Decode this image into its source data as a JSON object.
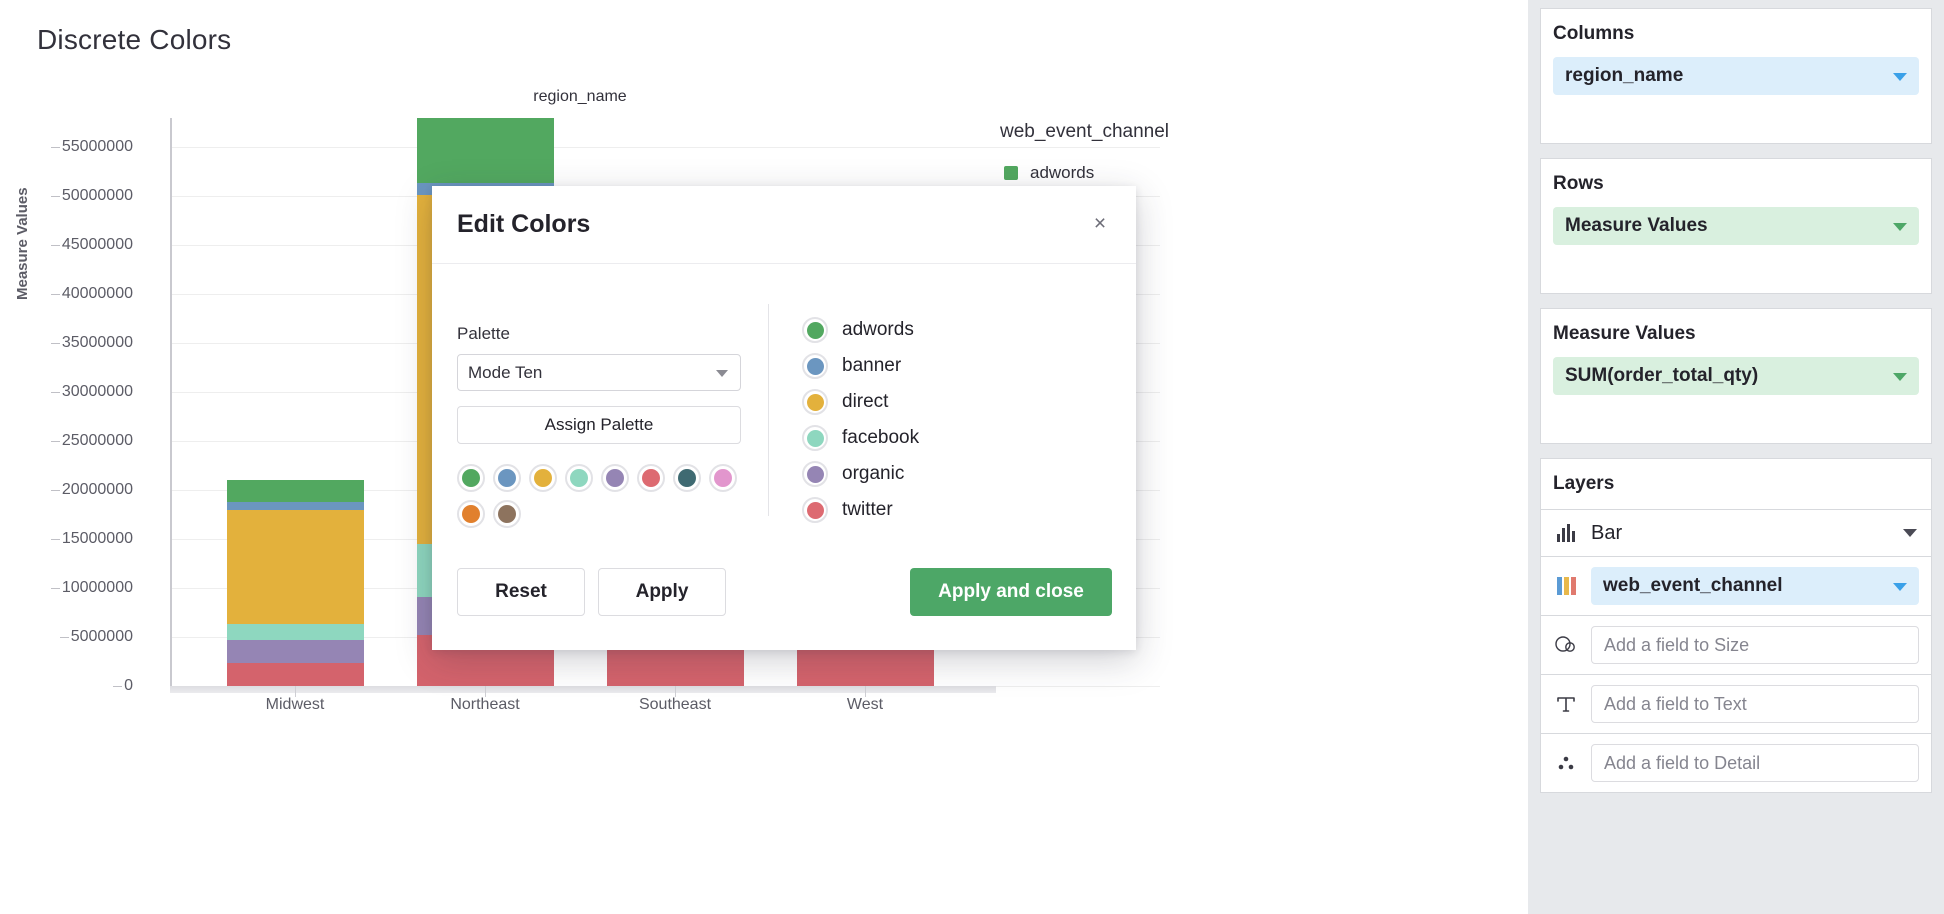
{
  "viz": {
    "title": "Discrete Colors",
    "columns_field_label": "region_name",
    "y_axis_title": "Measure Values",
    "legend_title": "web_event_channel",
    "legend_first_item": "adwords"
  },
  "chart_data": {
    "type": "bar",
    "title": "Discrete Colors",
    "xlabel": "region_name",
    "ylabel": "Measure Values",
    "ylim": [
      0,
      58000000
    ],
    "grid": true,
    "stacked": true,
    "legend_position": "right",
    "legend_title": "web_event_channel",
    "categories": [
      "Midwest",
      "Northeast",
      "Southeast",
      "West"
    ],
    "ytick_labels": [
      "0",
      "5000000",
      "10000000",
      "15000000",
      "20000000",
      "25000000",
      "30000000",
      "35000000",
      "40000000",
      "45000000",
      "50000000",
      "55000000"
    ],
    "ytick_values": [
      0,
      5000000,
      10000000,
      15000000,
      20000000,
      25000000,
      30000000,
      35000000,
      40000000,
      45000000,
      50000000,
      55000000
    ],
    "series": [
      {
        "name": "twitter",
        "color": "#d4636c",
        "values": [
          2300000,
          5200000,
          4300000,
          5100000
        ]
      },
      {
        "name": "organic",
        "color": "#9585b4",
        "values": [
          2400000,
          3900000,
          3600000,
          3700000
        ]
      },
      {
        "name": "facebook",
        "color": "#8ed7bf",
        "values": [
          1600000,
          5400000,
          0,
          0
        ]
      },
      {
        "name": "direct",
        "color": "#e3b13c",
        "values": [
          11700000,
          35600000,
          0,
          0
        ]
      },
      {
        "name": "banner",
        "color": "#6b96c0",
        "values": [
          800000,
          1300000,
          0,
          0
        ]
      },
      {
        "name": "adwords",
        "color": "#52a860",
        "values": [
          2200000,
          6600000,
          0,
          0
        ]
      }
    ]
  },
  "modal": {
    "title": "Edit Colors",
    "close_label": "×",
    "palette_label": "Palette",
    "palette_value": "Mode Ten",
    "assign_palette_label": "Assign Palette",
    "swatches": [
      {
        "name": "green",
        "color": "#52a860"
      },
      {
        "name": "blue",
        "color": "#6b96c0"
      },
      {
        "name": "yellow",
        "color": "#e3b13c"
      },
      {
        "name": "mint",
        "color": "#8ed7bf"
      },
      {
        "name": "purple",
        "color": "#9585b4"
      },
      {
        "name": "red",
        "color": "#dd6a71"
      },
      {
        "name": "dark-teal",
        "color": "#3f6a72"
      },
      {
        "name": "pink",
        "color": "#e296cd"
      },
      {
        "name": "orange",
        "color": "#e1802d"
      },
      {
        "name": "brown",
        "color": "#8d735e"
      }
    ],
    "legend_items": [
      {
        "label": "adwords",
        "color": "#52a860"
      },
      {
        "label": "banner",
        "color": "#6b96c0"
      },
      {
        "label": "direct",
        "color": "#e3b13c"
      },
      {
        "label": "facebook",
        "color": "#8ed7bf"
      },
      {
        "label": "organic",
        "color": "#9585b4"
      },
      {
        "label": "twitter",
        "color": "#dd6a71"
      }
    ],
    "reset_label": "Reset",
    "apply_label": "Apply",
    "apply_close_label": "Apply and close",
    "primary_color": "#4da767"
  },
  "sidebar": {
    "columns": {
      "title": "Columns",
      "field": "region_name"
    },
    "rows": {
      "title": "Rows",
      "field": "Measure Values"
    },
    "measure_values": {
      "title": "Measure Values",
      "field": "SUM(order_total_qty)"
    },
    "layers": {
      "title": "Layers",
      "mark_type": "Bar",
      "color_field": "web_event_channel",
      "size_placeholder": "Add a field to Size",
      "text_placeholder": "Add a field to Text",
      "detail_placeholder": "Add a field to Detail"
    }
  }
}
